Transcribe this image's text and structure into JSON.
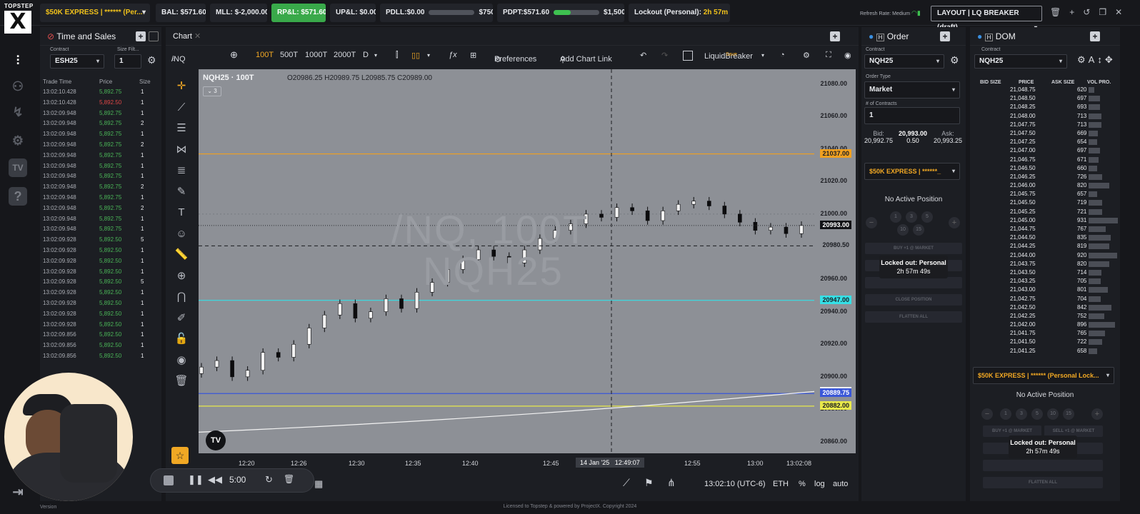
{
  "brand": {
    "small": "TOPSTEP",
    "mark": "X"
  },
  "topbar": {
    "account": "$50K EXPRESS | ****** (Per...",
    "bal": "BAL: $571.60",
    "mll": "MLL: $-2,000.00",
    "rpl": "RP&L: $571.60",
    "upl": "UP&L: $0.00",
    "pdll_label": "PDLL:$0.00",
    "pdll_max": "$750.00",
    "pdll_fraction": 0.0,
    "pdpt_label": "PDPT:$571.60",
    "pdpt_max": "$1,500.00",
    "pdpt_fraction": 0.38,
    "lockout_label": "Lockout (Personal):",
    "lockout_time": "2h 57m 49s",
    "refresh": "Refresh Rate: Medium",
    "layout": "LAYOUT | LQ BREAKER (draft)"
  },
  "time_sales": {
    "title": "Time and Sales",
    "contract_label": "Contract",
    "contract": "ESH25",
    "size_label": "Size Filt...",
    "size": "1",
    "headers": [
      "Trade Time",
      "Price",
      "Size"
    ],
    "rows": [
      [
        "13:02:10.428",
        "5,892.75",
        "1"
      ],
      [
        "13:02:10.428",
        "5,892.50",
        "1"
      ],
      [
        "13:02:09.948",
        "5,892.75",
        "1"
      ],
      [
        "13:02:09.948",
        "5,892.75",
        "2"
      ],
      [
        "13:02:09.948",
        "5,892.75",
        "1"
      ],
      [
        "13:02:09.948",
        "5,892.75",
        "2"
      ],
      [
        "13:02:09.948",
        "5,892.75",
        "1"
      ],
      [
        "13:02:09.948",
        "5,892.75",
        "1"
      ],
      [
        "13:02:09.948",
        "5,892.75",
        "1"
      ],
      [
        "13:02:09.948",
        "5,892.75",
        "2"
      ],
      [
        "13:02:09.948",
        "5,892.75",
        "1"
      ],
      [
        "13:02:09.948",
        "5,892.75",
        "2"
      ],
      [
        "13:02:09.948",
        "5,892.75",
        "1"
      ],
      [
        "13:02:09.948",
        "5,892.75",
        "1"
      ],
      [
        "13:02:09.928",
        "5,892.50",
        "5"
      ],
      [
        "13:02:09.928",
        "5,892.50",
        "1"
      ],
      [
        "13:02:09.928",
        "5,892.50",
        "1"
      ],
      [
        "13:02:09.928",
        "5,892.50",
        "1"
      ],
      [
        "13:02:09.928",
        "5,892.50",
        "5"
      ],
      [
        "13:02:09.928",
        "5,892.50",
        "1"
      ],
      [
        "13:02:09.928",
        "5,892.50",
        "1"
      ],
      [
        "13:02:09.928",
        "5,892.50",
        "1"
      ],
      [
        "13:02:09.928",
        "5,892.50",
        "1"
      ],
      [
        "13:02:09.856",
        "5,892.50",
        "1"
      ],
      [
        "13:02:09.856",
        "5,892.50",
        "1"
      ],
      [
        "13:02:09.856",
        "5,892.50",
        "1"
      ]
    ]
  },
  "chart": {
    "tab": "Chart",
    "symbol": "/NQ",
    "intervals": [
      "100T",
      "500T",
      "1000T",
      "2000T",
      "D"
    ],
    "preferences": "Preferences",
    "add_link": "Add Chart Link",
    "strategy": "LiquidBreaker",
    "strategy_sub": "Save",
    "legend_symbol": "NQH25 · 100T",
    "o": "20986.25",
    "h": "20989.75",
    "l": "20985.75",
    "c": "20989.00",
    "legend_count": "3",
    "watermark1": "/NQ, 100T",
    "watermark2": "NQH25",
    "price_axis": [
      "21080.00",
      "21060.00",
      "21040.00",
      "21020.00",
      "21000.00",
      "20980.00",
      "20960.00",
      "20940.00",
      "20920.00",
      "20900.00",
      "20880.00",
      "20860.00"
    ],
    "price_tags": {
      "orange": "21037.00",
      "last": "20993.00",
      "cross": "20980.50",
      "cyan": "20947.00",
      "white": "20890.56",
      "blue": "20889.75",
      "yellow": "20882.00"
    },
    "time_axis": [
      "12:20",
      "12:26",
      "12:30",
      "12:35",
      "12:40",
      "12:45",
      "12:55",
      "13:00",
      "13:02:08"
    ],
    "cross_date": "14 Jan '25",
    "cross_time": "12:49:07",
    "replay_time": "5:00",
    "clock": "13:02:10 (UTC-6)",
    "session": "ETH",
    "pct": "%",
    "log": "log",
    "auto": "auto",
    "colors": {
      "orange": "#f0a020",
      "cyan": "#35e0e6",
      "blue": "#3a57d8",
      "yellow": "#e8e84a"
    },
    "series_close": [
      20906,
      20910,
      20900,
      20904,
      20915,
      20912,
      20920,
      20930,
      20938,
      20945,
      20936,
      20940,
      20948,
      20942,
      20952,
      20958,
      20966,
      20972,
      20978,
      20974,
      20970,
      20978,
      20985,
      20990,
      20994,
      21000,
      20998,
      21004,
      21002,
      20996,
      21002,
      21006,
      21008,
      21005,
      21000,
      20995,
      20990,
      20992,
      20988,
      20993
    ]
  },
  "order": {
    "title": "Order",
    "contract_label": "Contract",
    "contract": "NQH25",
    "type_label": "Order Type",
    "type": "Market",
    "qty_label": "# of Contracts",
    "qty": "1",
    "bid_label": "Bid:",
    "bid": "20,992.75",
    "last": "20,993.00",
    "spread": "0.50",
    "ask_label": "Ask:",
    "ask": "20,993.25",
    "account": "$50K EXPRESS | ******_",
    "position": "No Active Position",
    "qty_buttons": [
      "1",
      "3",
      "5",
      "10",
      "15"
    ],
    "buy": "BUY +1 @ MARKET",
    "close": "CLOSE POSITION",
    "flatten": "FLATTEN ALL",
    "locked_title": "Locked out: Personal",
    "locked_time": "2h 57m 49s"
  },
  "dom": {
    "title": "DOM",
    "contract_label": "Contract",
    "contract": "NQH25",
    "headers": [
      "BID SIZE",
      "PRICE",
      "ASK SIZE",
      "VOL PRO."
    ],
    "rows": [
      [
        "21,048.75",
        "620"
      ],
      [
        "21,048.50",
        "697"
      ],
      [
        "21,048.25",
        "693"
      ],
      [
        "21,048.00",
        "713"
      ],
      [
        "21,047.75",
        "713"
      ],
      [
        "21,047.50",
        "669"
      ],
      [
        "21,047.25",
        "654"
      ],
      [
        "21,047.00",
        "697"
      ],
      [
        "21,046.75",
        "671"
      ],
      [
        "21,046.50",
        "660"
      ],
      [
        "21,046.25",
        "726"
      ],
      [
        "21,046.00",
        "820"
      ],
      [
        "21,045.75",
        "657"
      ],
      [
        "21,045.50",
        "719"
      ],
      [
        "21,045.25",
        "721"
      ],
      [
        "21,045.00",
        "931"
      ],
      [
        "21,044.75",
        "767"
      ],
      [
        "21,044.50",
        "835"
      ],
      [
        "21,044.25",
        "819"
      ],
      [
        "21,044.00",
        "920"
      ],
      [
        "21,043.75",
        "820"
      ],
      [
        "21,043.50",
        "714"
      ],
      [
        "21,043.25",
        "705"
      ],
      [
        "21,043.00",
        "801"
      ],
      [
        "21,042.75",
        "704"
      ],
      [
        "21,042.50",
        "842"
      ],
      [
        "21,042.25",
        "752"
      ],
      [
        "21,042.00",
        "896"
      ],
      [
        "21,041.75",
        "765"
      ],
      [
        "21,041.50",
        "722"
      ],
      [
        "21,041.25",
        "658"
      ]
    ],
    "account": "$50K EXPRESS | ****** (Personal Lock...",
    "position": "No Active Position",
    "qty_buttons": [
      "1",
      "3",
      "5",
      "10",
      "15"
    ],
    "buy": "BUY +1 @ MARKET",
    "sell": "SELL +1 @ MARKET",
    "flatten": "FLATTEN ALL",
    "locked_title": "Locked out: Personal",
    "locked_time": "2h 57m 49s"
  },
  "footer": "Licensed to Topstep & powered by ProjectX. Copyright 2024",
  "version": "Version"
}
